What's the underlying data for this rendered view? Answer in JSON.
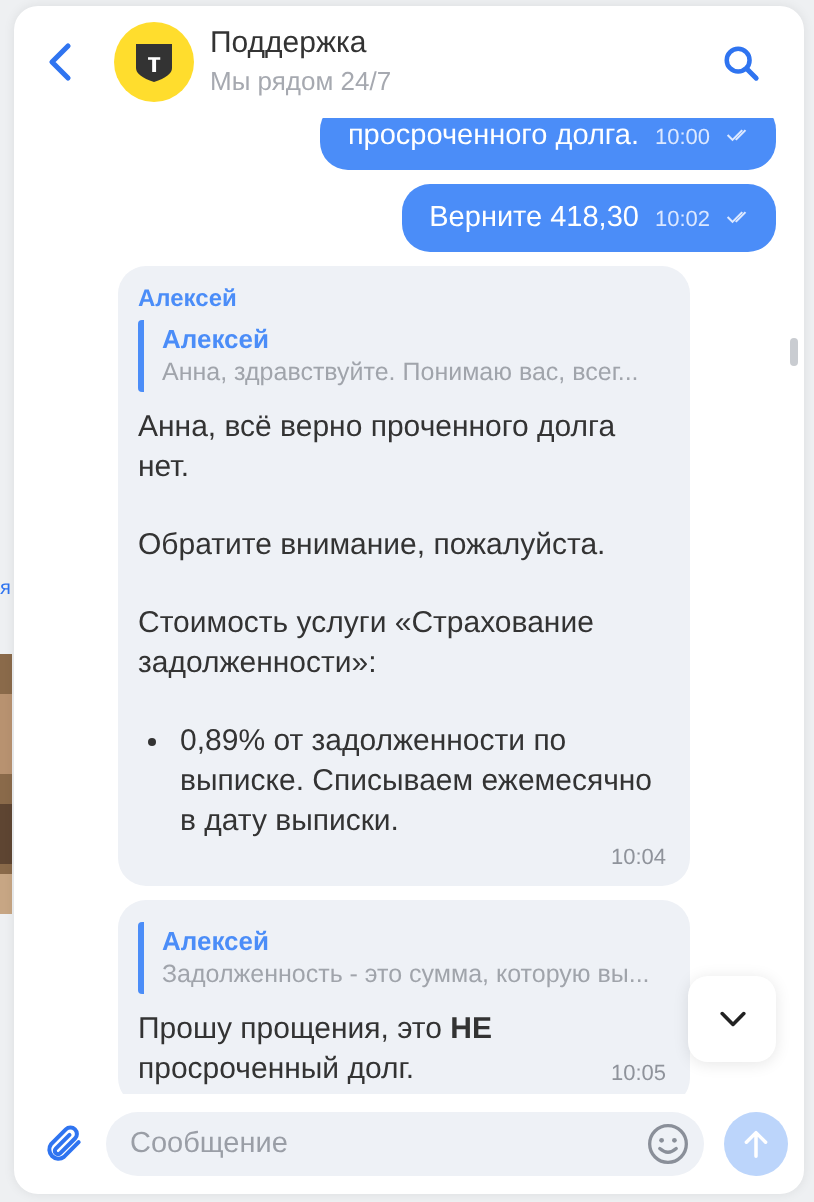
{
  "background": {
    "link_fragment": "я"
  },
  "header": {
    "title": "Поддержка",
    "subtitle": "Мы рядом 24/7",
    "logo_text": "т"
  },
  "messages": [
    {
      "kind": "outgoing",
      "text": "просроченного долга.",
      "time": "10:00",
      "read": true
    },
    {
      "kind": "outgoing",
      "text": "Верните 418,30",
      "time": "10:02",
      "read": true
    },
    {
      "kind": "incoming",
      "sender": "Алексей",
      "reply": {
        "author": "Алексей",
        "text": "Анна, здравствуйте. Понимаю вас, всег..."
      },
      "paragraphs": [
        "Анна, всё верно проченного долга нет.",
        "Обратите внимание, пожалуйста.",
        "Стоимость услуги «Страхование задолженности»:"
      ],
      "bullets": [
        "0,89% от задолженности по выписке. Списываем ежемесячно в дату выписки."
      ],
      "time": "10:04"
    },
    {
      "kind": "incoming",
      "reply": {
        "author": "Алексей",
        "text": "Задолженность - это сумма, которую вы..."
      },
      "paragraphs": [
        "Прошу прощения, это **НЕ** просроченный долг."
      ],
      "time": "10:05"
    }
  ],
  "composer": {
    "placeholder": "Сообщение",
    "send_disabled": true
  }
}
